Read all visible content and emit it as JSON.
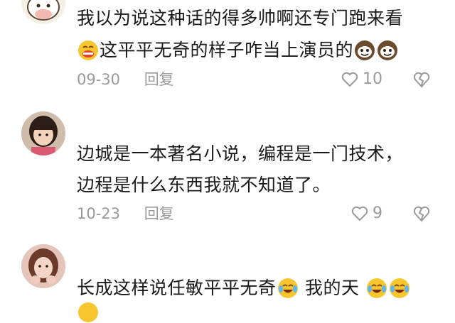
{
  "comments": [
    {
      "line1": "我以为说这种话的得多帅啊还专门跑来看",
      "line2": "这平平无奇的样子咋当上演员的",
      "emoji_leading": "grimace-emoji",
      "emoji_trailing": [
        "coconut-face-emoji",
        "coconut-face-emoji"
      ],
      "date": "09-30",
      "reply_label": "回复",
      "likes": "10"
    },
    {
      "line1": "边城是一本著名小说，编程是一门技术，",
      "line2": "边程是什么东西我就不知道了。",
      "date": "10-23",
      "reply_label": "回复",
      "likes": "9"
    },
    {
      "line1": "长成这样说任敏平平无奇",
      "line1_after_emoji": "我的天",
      "emoji_inline": "laugh-cry-emoji",
      "emoji_trailing": [
        "laugh-cry-emoji",
        "laugh-cry-emoji"
      ]
    }
  ],
  "colors": {
    "text": "#1a1a1a",
    "meta": "#9a9a9a",
    "emoji_yellow": "#f7c62f"
  }
}
